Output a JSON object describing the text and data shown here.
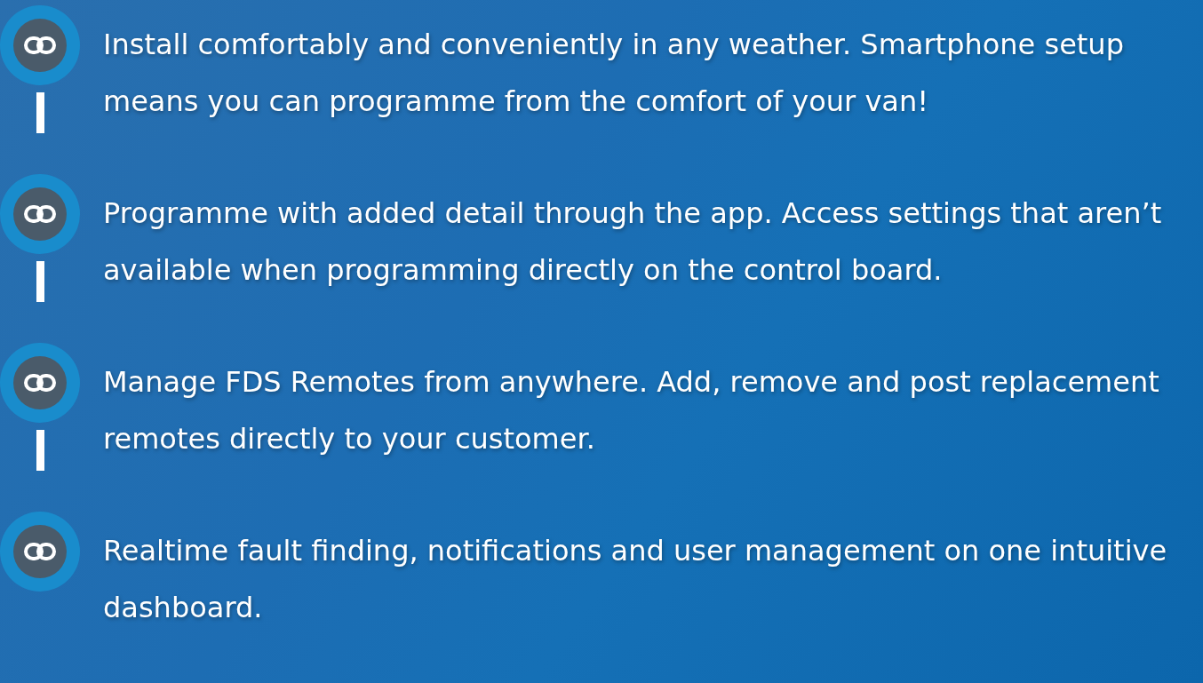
{
  "features": [
    {
      "text": "Install comfortably and conveniently in any weather. Smartphone setup means you can programme from the comfort of your van!"
    },
    {
      "text": "Programme with added detail through the app. Access settings that aren’t available when programming directly on the control board."
    },
    {
      "text": "Manage FDS Remotes from anywhere. Add, remove and post replacement remotes directly to your customer."
    },
    {
      "text": "Realtime fault finding, notifications and user management on one intuitive dashboard."
    }
  ]
}
